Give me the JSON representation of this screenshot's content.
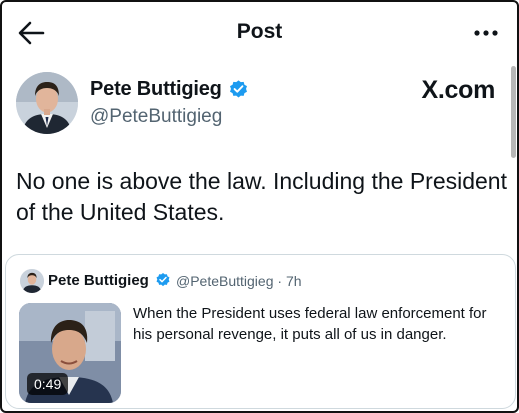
{
  "header": {
    "title": "Post",
    "back_icon": "arrow-left-icon",
    "more_icon": "more-horizontal-icon"
  },
  "author": {
    "name": "Pete Buttigieg",
    "handle": "@PeteButtigieg",
    "verified_icon": "verified-badge-icon",
    "badge_color": "#1d9bf0"
  },
  "watermark": "X.com",
  "post": {
    "text": "No one is above the law. Including the President of the United States."
  },
  "quoted_post": {
    "name": "Pete Buttigieg",
    "handle": "@PeteButtigieg",
    "separator": " · ",
    "age": "7h",
    "text": "When the President uses federal law enforcement for his personal revenge, it puts all of us in danger.",
    "video_duration": "0:49"
  }
}
